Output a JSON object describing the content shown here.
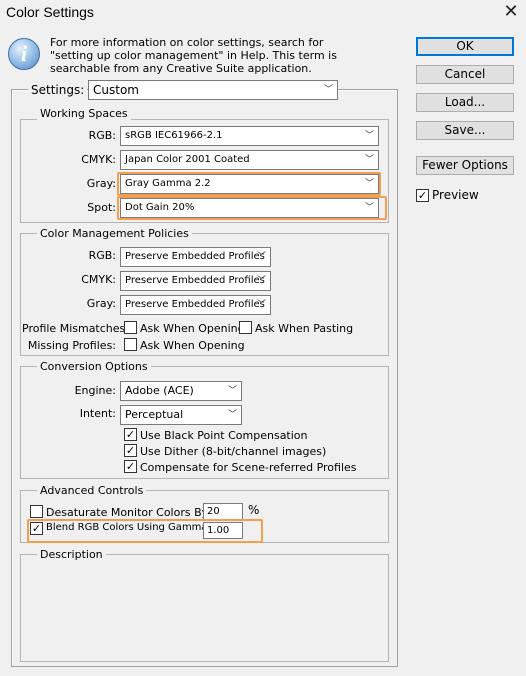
{
  "window": {
    "title": "Color Settings"
  },
  "info": {
    "text": "For more information on color settings, search for \"setting up color management\" in Help. This term is searchable from any Creative Suite application."
  },
  "buttons": {
    "ok": "OK",
    "cancel": "Cancel",
    "load": "Load...",
    "save": "Save...",
    "fewer_options": "Fewer Options"
  },
  "preview": {
    "label": "Preview",
    "checked": true
  },
  "settings": {
    "label": "Settings:",
    "value": "Custom"
  },
  "working_spaces": {
    "title": "Working Spaces",
    "rgb_label": "RGB:",
    "rgb_value": "sRGB IEC61966-2.1",
    "cmyk_label": "CMYK:",
    "cmyk_value": "Japan Color 2001 Coated",
    "gray_label": "Gray:",
    "gray_value": "Gray Gamma 2.2",
    "spot_label": "Spot:",
    "spot_value": "Dot Gain 20%"
  },
  "policies": {
    "title": "Color Management Policies",
    "rgb_label": "RGB:",
    "rgb_value": "Preserve Embedded Profiles",
    "cmyk_label": "CMYK:",
    "cmyk_value": "Preserve Embedded Profiles",
    "gray_label": "Gray:",
    "gray_value": "Preserve Embedded Profiles",
    "mismatch_label": "Profile Mismatches:",
    "ask_opening": "Ask When Opening",
    "ask_pasting": "Ask When Pasting",
    "missing_label": "Missing Profiles:",
    "missing_ask_opening": "Ask When Opening"
  },
  "conversion": {
    "title": "Conversion Options",
    "engine_label": "Engine:",
    "engine_value": "Adobe (ACE)",
    "intent_label": "Intent:",
    "intent_value": "Perceptual",
    "black_point": "Use Black Point Compensation",
    "dither": "Use Dither (8-bit/channel images)",
    "scene": "Compensate for Scene-referred Profiles"
  },
  "advanced": {
    "title": "Advanced Controls",
    "desaturate_label": "Desaturate Monitor Colors By:",
    "desaturate_value": "20",
    "percent": "%",
    "blend_label": "Blend RGB Colors Using Gamma:",
    "blend_value": "1.00"
  },
  "description": {
    "title": "Description"
  },
  "glyphs": {
    "close": "✕",
    "chevron": "﹀",
    "check": "✓",
    "info": "i"
  }
}
